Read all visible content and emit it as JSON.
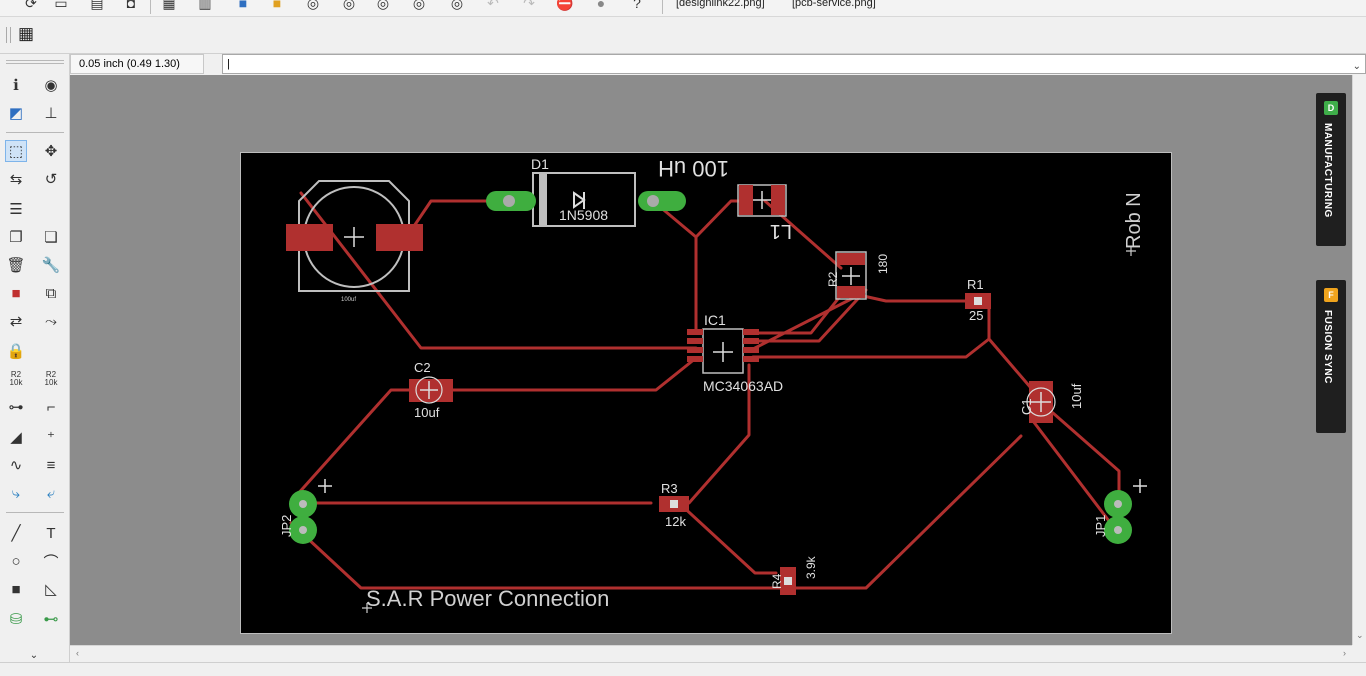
{
  "tabs": [
    "[designlink22.png]",
    "[pcb-service.png]"
  ],
  "toolbar": {
    "icons": [
      "open-icon",
      "save-icon",
      "print-icon",
      "camera-icon",
      "board-icon",
      "library-icon",
      "script-icon",
      "ulp-icon",
      "zoom-fit-icon",
      "zoom-in-icon",
      "zoom-out-icon",
      "zoom-select-icon",
      "zoom-area-icon",
      "undo-icon",
      "redo-icon",
      "stop-icon",
      "go-icon",
      "help-icon"
    ],
    "grid_icon": "grid-icon"
  },
  "coordinates": "0.05 inch (0.49 1.30)",
  "command_line": {
    "value": "|"
  },
  "palette_icons": [
    "info-icon",
    "eye-icon",
    "layer-icon",
    "mark-icon",
    "select-icon",
    "move-icon",
    "mirror-icon",
    "rotate-icon",
    "align-icon",
    "copy-icon",
    "paste-icon",
    "delete-icon",
    "wrench-icon",
    "add-icon",
    "replace-icon",
    "swap-icon",
    "smash-icon",
    "lock-icon",
    "name-icon",
    "value-icon",
    "split-icon",
    "miter-icon",
    "optimize-icon",
    "meander-icon",
    "route-icon",
    "ripup-icon",
    "line-icon",
    "text-icon",
    "circle-icon",
    "arc-icon",
    "rect-icon",
    "polygon-icon",
    "via-icon",
    "signal-icon",
    "more-icon"
  ],
  "palette_labels": {
    "name": "R2\n10k",
    "value": "R2\n10k"
  },
  "side_panels": [
    {
      "label": "MANUFACTURING",
      "badge": "D",
      "badge_color": "#3fae4a"
    },
    {
      "label": "FUSION SYNC",
      "badge": "F",
      "badge_color": "#f0a41d"
    }
  ],
  "board": {
    "trace_color": "#b0302f",
    "pad_color": "#3fae3f",
    "labels": {
      "d1_name": "D1",
      "d1_value": "1N5908",
      "l1_name": "L1",
      "l1_value": "100 uH",
      "r2_name": "R2",
      "r2_value": "180",
      "r1_name": "R1",
      "r1_value": "25",
      "ic1_name": "IC1",
      "ic1_value": "MC34063AD",
      "c2_name": "C2",
      "c2_value": "10uf",
      "c1_name": "C1",
      "c1_value": "10uf",
      "r3_name": "R3",
      "r3_value": "12k",
      "r4_name": "R4",
      "r4_value": "3.9k",
      "jp2_name": "JP2",
      "jp1_name": "JP1",
      "author": "Rob N",
      "title": "S.A.R Power Connection",
      "cap_value_small": "100uf"
    }
  }
}
